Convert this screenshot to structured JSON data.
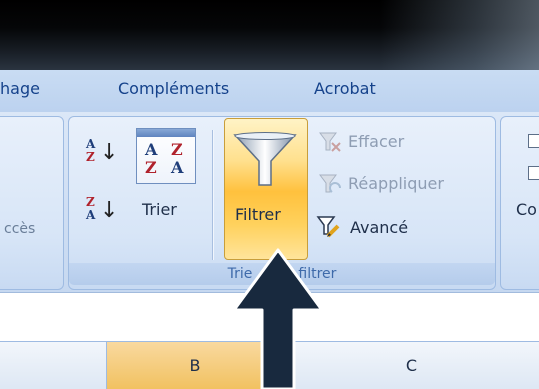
{
  "tabs": [
    "hage",
    "Compléments",
    "Acrobat"
  ],
  "left_group": {
    "partial_label": "ccès"
  },
  "sort_filter_group": {
    "label_before": "Trie",
    "label_after": "filtrer",
    "sort_az": {
      "top": "A",
      "bottom": "Z"
    },
    "sort_za": {
      "top": "Z",
      "bottom": "A"
    },
    "trier_icon_letters": [
      "A",
      "Z",
      "Z",
      "A"
    ],
    "trier_label": "Trier",
    "filtrer_label": "Filtrer",
    "effacer_label": "Effacer",
    "reappliquer_label": "Réappliquer",
    "avance_label": "Avancé"
  },
  "right_group": {
    "partial_label": "Co"
  },
  "columns": [
    {
      "label": "",
      "selected": false
    },
    {
      "label": "B",
      "selected": true
    },
    {
      "label": "C",
      "selected": false
    }
  ],
  "colors": {
    "highlight": "#ffc13d",
    "arrow": "#18293e",
    "ribbon_text": "#15428b"
  }
}
